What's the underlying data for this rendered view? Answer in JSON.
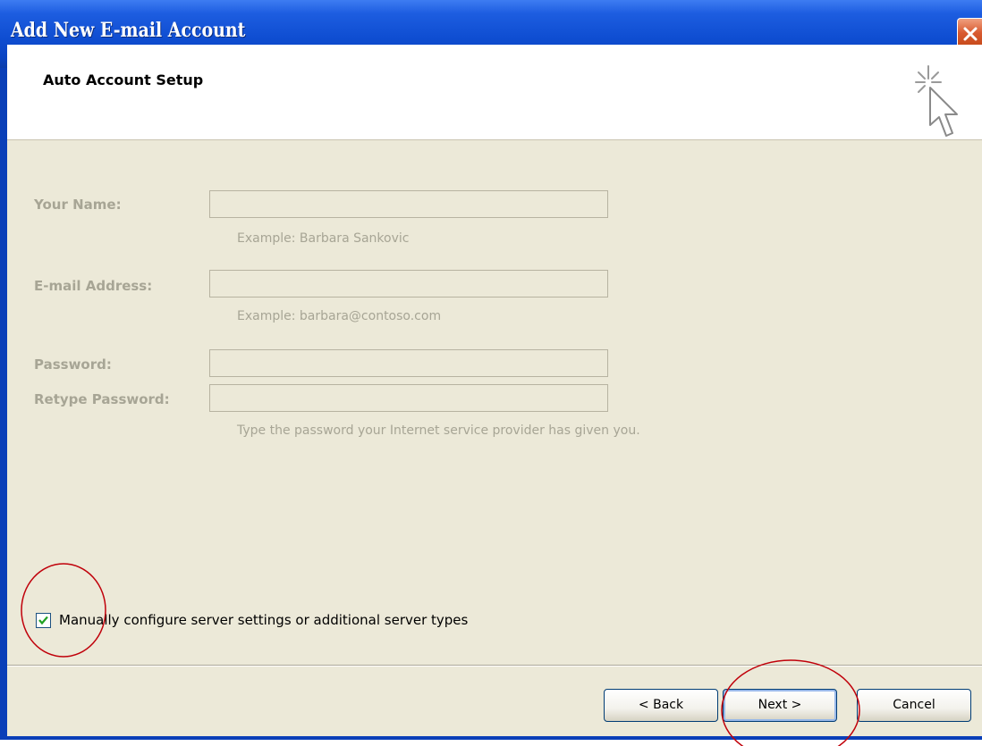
{
  "window": {
    "title": "Add New E-mail Account"
  },
  "header": {
    "title": "Auto Account Setup"
  },
  "form": {
    "name": {
      "label": "Your Name:",
      "value": "",
      "hint": "Example: Barbara Sankovic"
    },
    "email": {
      "label": "E-mail Address:",
      "value": "",
      "hint": "Example: barbara@contoso.com"
    },
    "password": {
      "label": "Password:",
      "value": ""
    },
    "retype": {
      "label": "Retype Password:",
      "value": "",
      "hint": "Type the password your Internet service provider has given you."
    }
  },
  "manual_config": {
    "label": "Manually configure server settings or additional server types",
    "checked": true
  },
  "buttons": {
    "back": "< Back",
    "next": "Next >",
    "cancel": "Cancel"
  },
  "annotation_color": "#c0000a"
}
